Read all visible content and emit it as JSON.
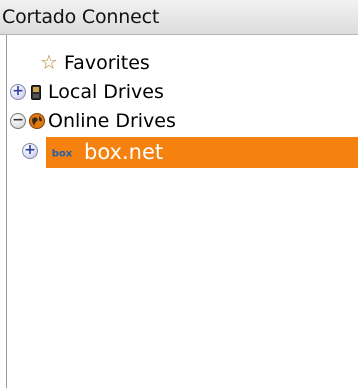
{
  "window": {
    "title": "Cortado Connect"
  },
  "tree": {
    "items": [
      {
        "label": "Favorites",
        "icon": "star-icon",
        "expander": ""
      },
      {
        "label": "Local Drives",
        "icon": "phone-icon",
        "expander": "+"
      },
      {
        "label": "Online Drives",
        "icon": "globe-icon",
        "expander": "−"
      },
      {
        "label": "box.net",
        "icon": "box-logo-icon",
        "expander": "+",
        "selected": true
      }
    ]
  },
  "colors": {
    "selection": "#f5820e",
    "star": "#b8842e",
    "expander_accent": "#2f3fa0"
  }
}
